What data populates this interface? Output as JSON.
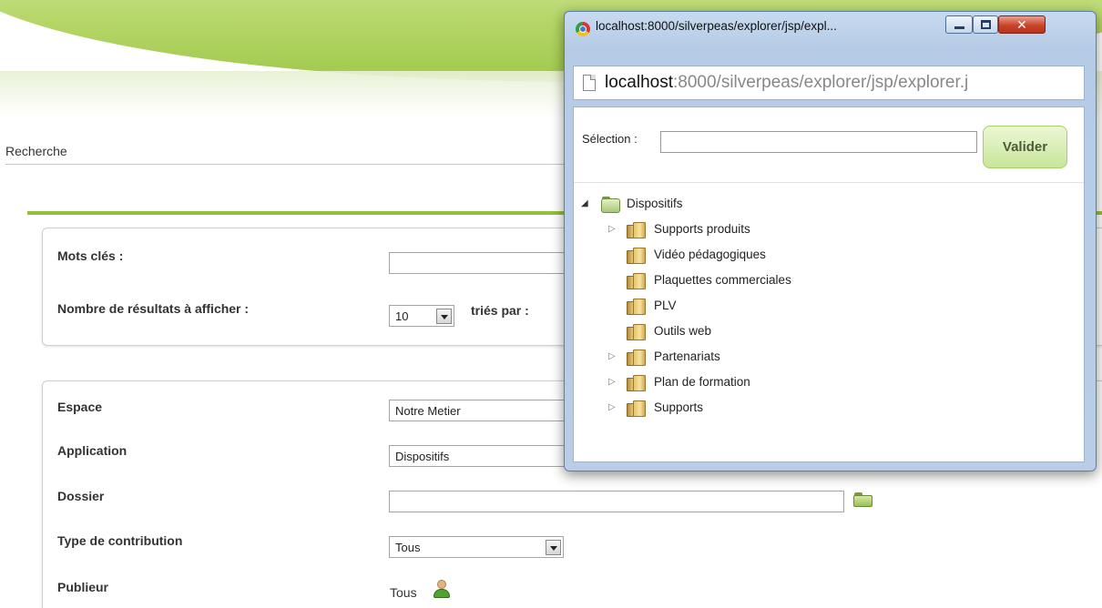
{
  "page": {
    "breadcrumb": "Recherche",
    "search": {
      "keywords_label": "Mots clés :",
      "keywords_value": "",
      "results_label": "Nombre de résultats à afficher :",
      "results_value": "10",
      "sort_label": "triés par :"
    },
    "filters": {
      "espace_label": "Espace",
      "espace_value": "Notre Metier",
      "application_label": "Application",
      "application_value": "Dispositifs",
      "dossier_label": "Dossier",
      "dossier_value": "",
      "type_label": "Type de contribution",
      "type_value": "Tous",
      "publieur_label": "Publieur",
      "publieur_value": "Tous"
    }
  },
  "popup": {
    "window_title": "localhost:8000/silverpeas/explorer/jsp/expl...",
    "url_host": "localhost",
    "url_rest": ":8000/silverpeas/explorer/jsp/explorer.j",
    "selection_label": "Sélection :",
    "selection_value": "",
    "validate_label": "Valider",
    "tree": {
      "root": "Dispositifs",
      "children": [
        {
          "label": "Supports produits",
          "expandable": true
        },
        {
          "label": "Vidéo pédagogiques",
          "expandable": false
        },
        {
          "label": "Plaquettes commerciales",
          "expandable": false
        },
        {
          "label": "PLV",
          "expandable": false
        },
        {
          "label": "Outils web",
          "expandable": false
        },
        {
          "label": "Partenariats",
          "expandable": true
        },
        {
          "label": "Plan de formation",
          "expandable": true
        },
        {
          "label": "Supports",
          "expandable": true
        }
      ]
    }
  },
  "icons": {
    "browser": "chrome-icon",
    "page": "page-icon",
    "folder": "folder-icon",
    "user": "user-icon"
  },
  "colors": {
    "accent_green": "#8fc23a",
    "button_green": "#c8e59a",
    "window_frame": "#b6cbe6",
    "close_red": "#c8442a"
  }
}
